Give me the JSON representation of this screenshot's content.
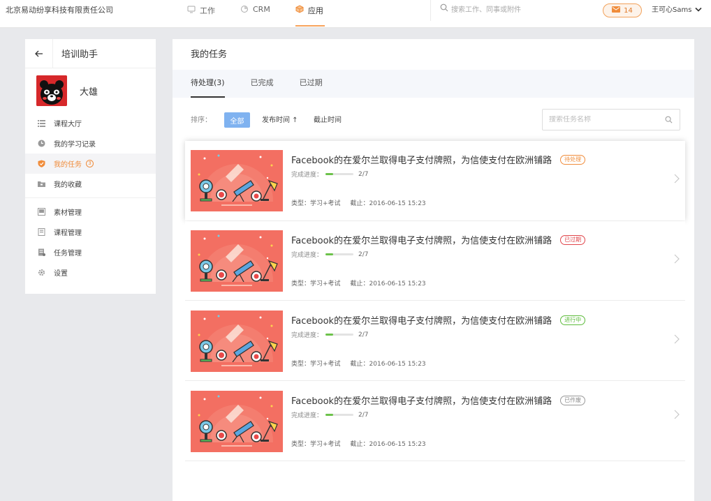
{
  "header": {
    "company": "北京易动纷享科技有限责任公司",
    "nav": [
      {
        "label": "工作",
        "icon": "work-icon"
      },
      {
        "label": "CRM",
        "icon": "crm-icon"
      },
      {
        "label": "应用",
        "icon": "app-cube-icon",
        "active": true
      }
    ],
    "search_placeholder": "搜索工作、同事或附件",
    "mail_count": "14",
    "user_name": "王可心Sams"
  },
  "sidebar": {
    "title": "培训助手",
    "user_name": "大雄",
    "items": [
      {
        "label": "课程大厅",
        "icon": "list-icon"
      },
      {
        "label": "我的学习记录",
        "icon": "clock-icon"
      },
      {
        "label": "我的任务",
        "icon": "shield-icon",
        "active": true,
        "count": "3"
      },
      {
        "label": "我的收藏",
        "icon": "folder-icon"
      },
      {
        "label": "素材管理",
        "icon": "media-icon"
      },
      {
        "label": "课程管理",
        "icon": "book-icon"
      },
      {
        "label": "任务管理",
        "icon": "task-icon"
      },
      {
        "label": "设置",
        "icon": "gear-icon"
      }
    ]
  },
  "main": {
    "title": "我的任务",
    "tabs": [
      {
        "label": "待处理(3)",
        "active": true
      },
      {
        "label": "已完成"
      },
      {
        "label": "已过期"
      }
    ],
    "sort": {
      "label": "排序：",
      "all": "全部",
      "publish_time": "发布时间 ↑",
      "deadline": "截止时间",
      "search_placeholder": "搜索任务名称"
    },
    "tasks": [
      {
        "title": "Facebook的在爱尔兰取得电子支付牌照，为信使支付在欧洲铺路",
        "status": "待处理",
        "status_type": "pending",
        "progress_label": "完成进度：",
        "progress_text": "2/7",
        "progress": 0.2857,
        "type": "类型：学习+考试",
        "deadline": "截止：2016-06-15 15:23"
      },
      {
        "title": "Facebook的在爱尔兰取得电子支付牌照，为信使支付在欧洲铺路",
        "status": "已过期",
        "status_type": "expired",
        "progress_label": "完成进度：",
        "progress_text": "2/7",
        "progress": 0.2857,
        "type": "类型：学习+考试",
        "deadline": "截止：2016-06-15 15:23"
      },
      {
        "title": "Facebook的在爱尔兰取得电子支付牌照，为信使支付在欧洲铺路",
        "status": "进行中",
        "status_type": "progress",
        "progress_label": "完成进度：",
        "progress_text": "2/7",
        "progress": 0.2857,
        "type": "类型：学习+考试",
        "deadline": "截止：2016-06-15 15:23"
      },
      {
        "title": "Facebook的在爱尔兰取得电子支付牌照，为信使支付在欧洲铺路",
        "status": "已作废",
        "status_type": "void",
        "progress_label": "完成进度：",
        "progress_text": "2/7",
        "progress": 0.2857,
        "type": "类型：学习+考试",
        "deadline": "截止：2016-06-15 15:23"
      }
    ]
  },
  "colors": {
    "accent": "#f08c3a",
    "primary_button": "#7fb2f0",
    "progress": "#6cc24a",
    "thumbnail_bg": "#f36f62"
  }
}
